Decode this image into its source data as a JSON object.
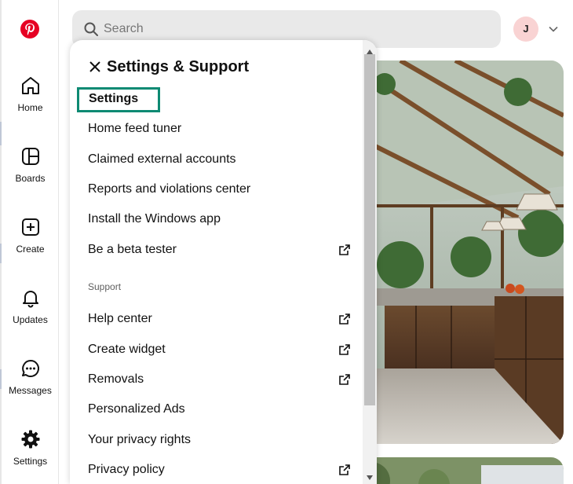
{
  "sidebar": {
    "items": [
      {
        "label": "Home"
      },
      {
        "label": "Boards"
      },
      {
        "label": "Create"
      },
      {
        "label": "Updates"
      },
      {
        "label": "Messages"
      },
      {
        "label": "Settings"
      }
    ]
  },
  "header": {
    "search_placeholder": "Search",
    "avatar_initial": "J"
  },
  "menu": {
    "title": "Settings & Support",
    "items": [
      {
        "label": "Settings",
        "external": false
      },
      {
        "label": "Home feed tuner",
        "external": false
      },
      {
        "label": "Claimed external accounts",
        "external": false
      },
      {
        "label": "Reports and violations center",
        "external": false
      },
      {
        "label": "Install the Windows app",
        "external": false
      },
      {
        "label": "Be a beta tester",
        "external": true
      }
    ],
    "support_label": "Support",
    "support_items": [
      {
        "label": "Help center",
        "external": true
      },
      {
        "label": "Create widget",
        "external": true
      },
      {
        "label": "Removals",
        "external": true
      },
      {
        "label": "Personalized Ads",
        "external": false
      },
      {
        "label": "Your privacy rights",
        "external": false
      },
      {
        "label": "Privacy policy",
        "external": true
      }
    ]
  },
  "colors": {
    "brand": "#e60023",
    "focus": "#0e8a73",
    "avatar_bg": "#f9d3d3"
  }
}
